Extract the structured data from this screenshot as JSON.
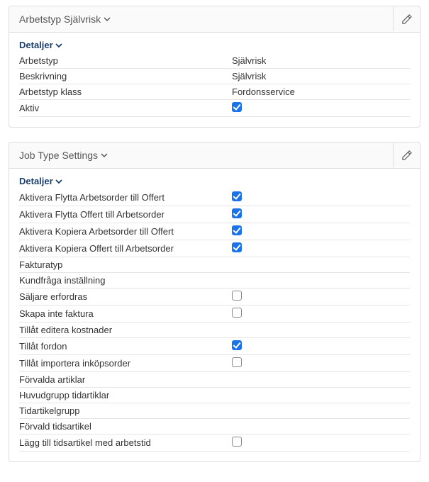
{
  "card1": {
    "title": "Arbetstyp Självrisk",
    "detailsLabel": "Detaljer",
    "rows": [
      {
        "label": "Arbetstyp",
        "type": "text",
        "value": "Självrisk"
      },
      {
        "label": "Beskrivning",
        "type": "text",
        "value": "Självrisk"
      },
      {
        "label": "Arbetstyp klass",
        "type": "text",
        "value": "Fordonsservice"
      },
      {
        "label": "Aktiv",
        "type": "checkbox",
        "checked": true
      }
    ]
  },
  "card2": {
    "title": "Job Type Settings",
    "detailsLabel": "Detaljer",
    "rows": [
      {
        "label": "Aktivera Flytta Arbetsorder till Offert",
        "type": "checkbox",
        "checked": true
      },
      {
        "label": "Aktivera Flytta Offert till Arbetsorder",
        "type": "checkbox",
        "checked": true
      },
      {
        "label": "Aktivera Kopiera Arbetsorder till Offert",
        "type": "checkbox",
        "checked": true
      },
      {
        "label": "Aktivera Kopiera Offert till Arbetsorder",
        "type": "checkbox",
        "checked": true
      },
      {
        "label": "Fakturatyp",
        "type": "text",
        "value": ""
      },
      {
        "label": "Kundfråga inställning",
        "type": "text",
        "value": ""
      },
      {
        "label": "Säljare erfordras",
        "type": "checkbox",
        "checked": false
      },
      {
        "label": "Skapa inte faktura",
        "type": "checkbox",
        "checked": false
      },
      {
        "label": "Tillåt editera kostnader",
        "type": "text",
        "value": ""
      },
      {
        "label": "Tillåt fordon",
        "type": "checkbox",
        "checked": true
      },
      {
        "label": "Tillåt importera inköpsorder",
        "type": "checkbox",
        "checked": false
      },
      {
        "label": "Förvalda artiklar",
        "type": "text",
        "value": ""
      },
      {
        "label": "Huvudgrupp tidartiklar",
        "type": "text",
        "value": ""
      },
      {
        "label": "Tidartikelgrupp",
        "type": "text",
        "value": ""
      },
      {
        "label": "Förvald tidsartikel",
        "type": "text",
        "value": ""
      },
      {
        "label": "Lägg till tidsartikel med arbetstid",
        "type": "checkbox",
        "checked": false
      }
    ]
  }
}
